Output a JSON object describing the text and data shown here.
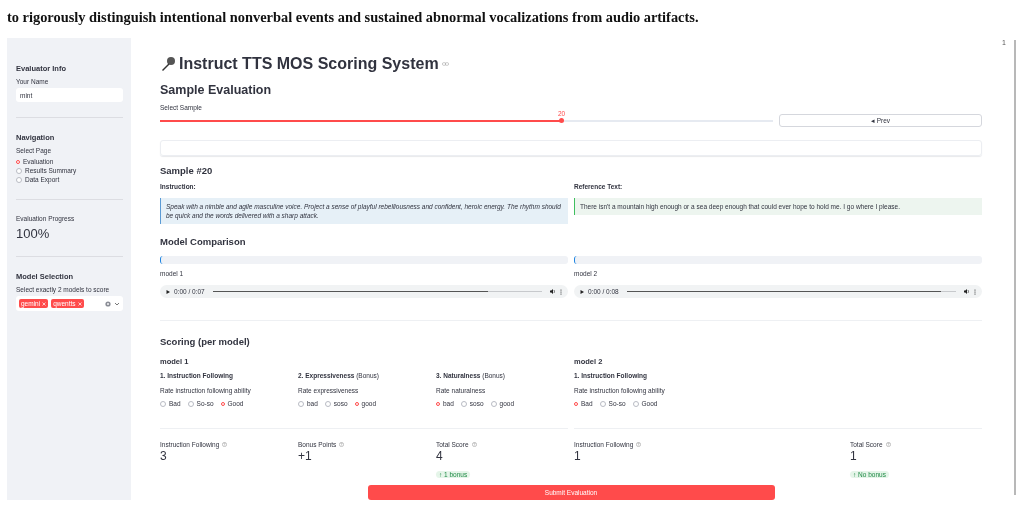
{
  "caption_line": "to rigorously distinguish intentional nonverbal events and sustained abnormal vocalizations from audio artifacts.",
  "corner_mark": "1",
  "sidebar": {
    "sections": [
      {
        "kind": "input",
        "title": "Evaluator Info",
        "label": "Your Name",
        "value": "mint"
      },
      {
        "kind": "radio",
        "title": "Navigation",
        "label": "Select Page",
        "options": [
          {
            "label": "Evaluation",
            "selected": true
          },
          {
            "label": "Results Summary",
            "selected": false
          },
          {
            "label": "Data Export",
            "selected": false
          }
        ]
      },
      {
        "kind": "metric",
        "label": "Evaluation Progress",
        "value": "100%"
      },
      {
        "kind": "multiselect",
        "title": "Model Selection",
        "label": "Select exactly 2 models to score",
        "chips": [
          "gemini",
          "qwentts"
        ]
      }
    ]
  },
  "title": "Instruct TTS MOS Scoring System",
  "evaluation": {
    "heading": "Sample Evaluation",
    "slider": {
      "label": "Select Sample",
      "reading": "20",
      "level": 0.655
    },
    "prev_button": "◂ Prev"
  },
  "sample": {
    "heading": "Sample #20",
    "instruction_label": "Instruction:",
    "instruction": "Speak with a nimble and agile masculine voice. Project a sense of playful rebelliousness and confident, heroic energy. The rhythm should be quick and the words delivered with a sharp attack.",
    "reference_label": "Reference Text:",
    "reference": "There isn't a mountain high enough or a sea deep enough that could ever hope to hold me. I go where I please."
  },
  "comparison": {
    "heading": "Model Comparison",
    "players": [
      {
        "label": "model 1",
        "time": "0:00 / 0:07",
        "level": 0.835
      },
      {
        "label": "model 2",
        "time": "0:00 / 0:08",
        "level": 0.955
      }
    ]
  },
  "scoring": {
    "heading": "Scoring (per model)",
    "models": [
      {
        "name": "model 1",
        "criteria": [
          {
            "title": "1. Instruction Following",
            "prompt": "Rate instruction following ability",
            "options": [
              {
                "label": "Bad",
                "selected": false
              },
              {
                "label": "So-so",
                "selected": false
              },
              {
                "label": "Good",
                "selected": true
              }
            ]
          },
          {
            "title": "2. Expressiveness",
            "note": "(Bonus)",
            "prompt": "Rate expressiveness",
            "options": [
              {
                "label": "bad",
                "selected": false
              },
              {
                "label": "soso",
                "selected": false
              },
              {
                "label": "good",
                "selected": true
              }
            ]
          },
          {
            "title": "3. Naturalness",
            "note": "(Bonus)",
            "prompt": "Rate naturalness",
            "options": [
              {
                "label": "bad",
                "selected": true
              },
              {
                "label": "soso",
                "selected": false
              },
              {
                "label": "good",
                "selected": false
              }
            ]
          }
        ],
        "metrics": [
          {
            "label": "Instruction Following",
            "value": "3"
          },
          {
            "label": "Bonus Points",
            "value": "+1"
          },
          {
            "label": "Total Score",
            "value": "4",
            "delta": "↑ 1 bonus"
          }
        ]
      },
      {
        "name": "model 2",
        "criteria": [
          {
            "title": "1. Instruction Following",
            "prompt": "Rate instruction following ability",
            "options": [
              {
                "label": "Bad",
                "selected": true
              },
              {
                "label": "So-so",
                "selected": false
              },
              {
                "label": "Good",
                "selected": false
              }
            ]
          }
        ],
        "metrics": [
          {
            "label": "Instruction Following",
            "value": "1"
          },
          {
            "label": "Total Score",
            "value": "1",
            "delta": "↑ No bonus"
          }
        ]
      }
    ]
  },
  "submit_button": "Submit Evaluation"
}
